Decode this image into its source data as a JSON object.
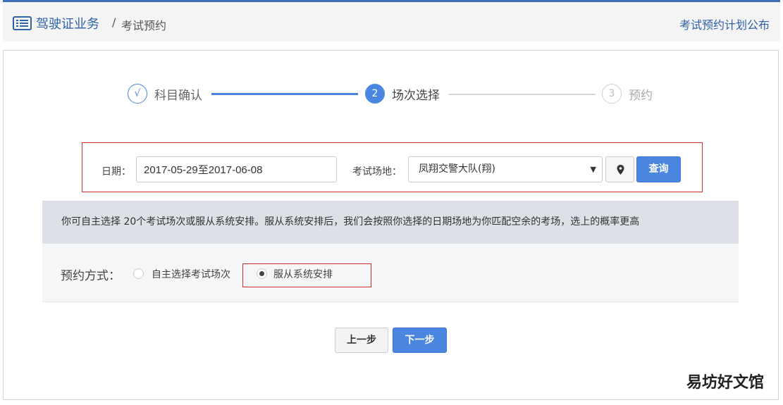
{
  "header": {
    "brand": "驾驶证业务",
    "separator": "/",
    "crumb": "考试预约",
    "plan_link": "考试预约计划公布"
  },
  "steps": [
    {
      "marker": "√",
      "label": "科目确认",
      "state": "done"
    },
    {
      "marker": "2",
      "label": "场次选择",
      "state": "active"
    },
    {
      "marker": "3",
      "label": "预约",
      "state": "pending"
    }
  ],
  "filter": {
    "date_label": "日期：",
    "date_value": "2017-05-29至2017-06-08",
    "venue_label": "考试场地：",
    "venue_value": "凤翔交警大队(翔)",
    "query_label": "查询"
  },
  "notice": "你可自主选择 20个考试场次或服从系统安排。服从系统安排后，我们会按照你选择的日期场地为你匹配空余的考场，选上的概率更高",
  "mode": {
    "label": "预约方式：",
    "options": [
      {
        "label": "自主选择考试场次",
        "selected": false
      },
      {
        "label": "服从系统安排",
        "selected": true
      }
    ]
  },
  "actions": {
    "prev": "上一步",
    "next": "下一步"
  },
  "watermark": "易坊好文馆",
  "colors": {
    "accent": "#4a86e0",
    "brand": "#2f62a8",
    "highlight": "#cc2e2e"
  }
}
